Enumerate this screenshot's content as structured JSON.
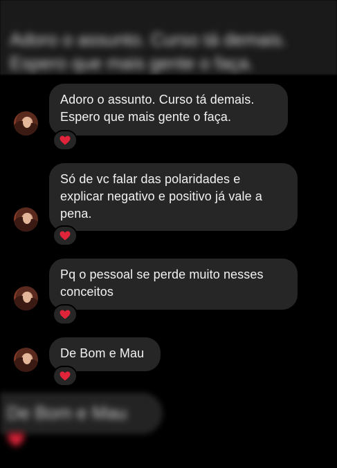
{
  "blurred_header": {
    "line1": "Adoro o assunto. Curso tá demais.",
    "line2": "Espero que mais gente o faça."
  },
  "messages": [
    {
      "lines": [
        "Adoro o assunto. Curso tá demais.",
        "Espero que mais gente o faça."
      ],
      "reaction": "heart-icon"
    },
    {
      "lines": [
        "Só de vc falar das polaridades e",
        "explicar negativo e positivo já vale a",
        "pena."
      ],
      "reaction": "heart-icon"
    },
    {
      "lines": [
        "Pq o pessoal se perde muito nesses",
        "conceitos"
      ],
      "reaction": "heart-icon"
    },
    {
      "lines": [
        "De Bom e Mau"
      ],
      "reaction": "heart-icon"
    }
  ],
  "blurred_footer": {
    "text": "De Bom e Mau"
  },
  "colors": {
    "background": "#000000",
    "bubble": "#262626",
    "text": "#f2f2f2",
    "heart": "#e0243a"
  }
}
